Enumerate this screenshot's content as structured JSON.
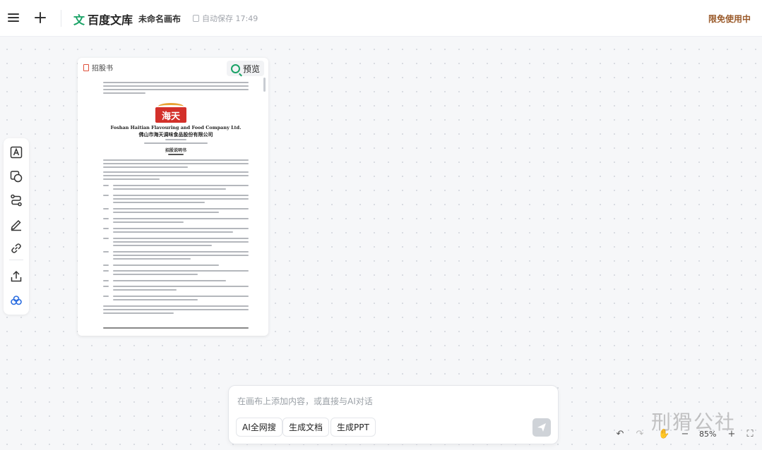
{
  "header": {
    "brand_icon": "文",
    "brand_name": "百度文库",
    "doc_title": "未命名画布",
    "autosave": "自动保存 17:49",
    "free_badge": "限免使用中"
  },
  "toolbar": {
    "items": [
      {
        "name": "text-tool",
        "icon": "text-box-icon"
      },
      {
        "name": "shape-tool",
        "icon": "shapes-icon"
      },
      {
        "name": "connector-tool",
        "icon": "connector-icon"
      },
      {
        "name": "pen-tool",
        "icon": "pen-icon"
      },
      {
        "name": "link-tool",
        "icon": "link-icon"
      },
      {
        "name": "upload-tool",
        "icon": "upload-icon"
      },
      {
        "name": "ai-tool",
        "icon": "ai-cloud-icon"
      }
    ]
  },
  "doc_card": {
    "file_name": "招股书",
    "preview_label": "预览",
    "company_en": "Foshan Haitian Flavouring and Food Company Ltd.",
    "company_cn": "佛山市海天调味食品股份有限公司",
    "logo_text": "海天",
    "page_heading": "招股说明书"
  },
  "chat": {
    "placeholder": "在画布上添加内容，或直接与AI对话",
    "chips": [
      "AI全网搜",
      "生成文档",
      "生成PPT"
    ]
  },
  "zoom": {
    "value": "85%"
  },
  "watermark": "刑猾公社",
  "colors": {
    "brand_green": "#1aa266",
    "badge_brown": "#9a5a2a",
    "logo_red": "#d3302a"
  }
}
